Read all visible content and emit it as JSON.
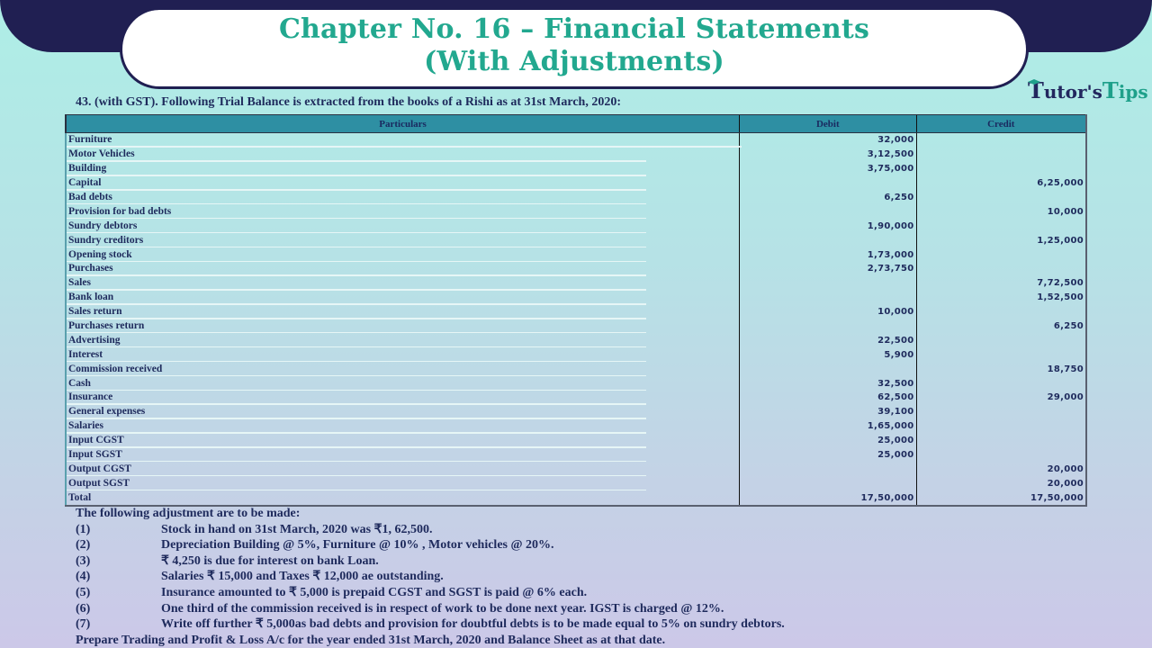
{
  "header": {
    "title_line1": "Chapter No. 16 – Financial Statements",
    "title_line2": "(With Adjustments)",
    "logo": {
      "part1": "T",
      "part2": "utor's",
      "part3": "T",
      "part4": "ips",
      "icon": "graduation-cap-icon"
    }
  },
  "question": "43. (with GST). Following Trial Balance is extracted from the books of a Rishi as at 31st March, 2020:",
  "trial_balance": {
    "columns": [
      "Particulars",
      "Debit",
      "Credit"
    ],
    "rows": [
      {
        "particular": "Furniture",
        "debit": "32,000",
        "credit": ""
      },
      {
        "particular": "Motor Vehicles",
        "debit": "3,12,500",
        "credit": ""
      },
      {
        "particular": "Building",
        "debit": "3,75,000",
        "credit": ""
      },
      {
        "particular": "Capital",
        "debit": "",
        "credit": "6,25,000"
      },
      {
        "particular": "Bad debts",
        "debit": "6,250",
        "credit": ""
      },
      {
        "particular": "Provision for bad debts",
        "debit": "",
        "credit": "10,000"
      },
      {
        "particular": "Sundry debtors",
        "debit": "1,90,000",
        "credit": ""
      },
      {
        "particular": "Sundry creditors",
        "debit": "",
        "credit": "1,25,000"
      },
      {
        "particular": "Opening stock",
        "debit": "1,73,000",
        "credit": ""
      },
      {
        "particular": "Purchases",
        "debit": "2,73,750",
        "credit": ""
      },
      {
        "particular": "Sales",
        "debit": "",
        "credit": "7,72,500"
      },
      {
        "particular": "Bank loan",
        "debit": "",
        "credit": "1,52,500"
      },
      {
        "particular": "Sales return",
        "debit": "10,000",
        "credit": ""
      },
      {
        "particular": "Purchases return",
        "debit": "",
        "credit": "6,250"
      },
      {
        "particular": "Advertising",
        "debit": "22,500",
        "credit": ""
      },
      {
        "particular": "Interest",
        "debit": "5,900",
        "credit": ""
      },
      {
        "particular": "Commission received",
        "debit": "",
        "credit": "18,750"
      },
      {
        "particular": "Cash",
        "debit": "32,500",
        "credit": ""
      },
      {
        "particular": "Insurance",
        "debit": "62,500",
        "credit": "29,000"
      },
      {
        "particular": "General expenses",
        "debit": "39,100",
        "credit": ""
      },
      {
        "particular": "Salaries",
        "debit": "1,65,000",
        "credit": ""
      },
      {
        "particular": "Input CGST",
        "debit": "25,000",
        "credit": ""
      },
      {
        "particular": "Input SGST",
        "debit": "25,000",
        "credit": ""
      },
      {
        "particular": "Output CGST",
        "debit": "",
        "credit": "20,000"
      },
      {
        "particular": "Output SGST",
        "debit": "",
        "credit": "20,000"
      }
    ],
    "total": {
      "particular": "Total",
      "debit": "17,50,000",
      "credit": "17,50,000"
    }
  },
  "adjustments": {
    "heading": "The following adjustment are to be made:",
    "items": [
      {
        "num": "(1)",
        "text": "Stock in hand on 31st March, 2020 was ₹1, 62,500."
      },
      {
        "num": "(2)",
        "text": "Depreciation Building @ 5%, Furniture @ 10% , Motor vehicles @ 20%."
      },
      {
        "num": "(3)",
        "text": "₹ 4,250 is due for interest on bank Loan."
      },
      {
        "num": "(4)",
        "text": "Salaries ₹ 15,000 and Taxes ₹ 12,000 ae outstanding."
      },
      {
        "num": "(5)",
        "text": "Insurance amounted to ₹ 5,000 is prepaid CGST and SGST is paid @ 6% each."
      },
      {
        "num": "(6)",
        "text": "One third of the commission received is in respect of work to be done next year. IGST is charged @ 12%."
      },
      {
        "num": "(7)",
        "text": "Write off further ₹ 5,000as bad debts and provision for doubtful debts is to be made equal to 5% on sundry debtors."
      }
    ],
    "footer": "Prepare Trading and Profit & Loss A/c for the year ended 31st March, 2020 and Balance Sheet as at that date."
  }
}
